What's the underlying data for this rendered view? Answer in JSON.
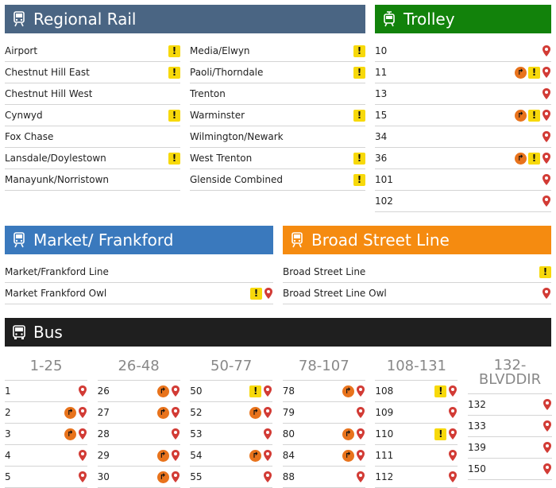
{
  "colors": {
    "regional": "#4a6583",
    "trolley": "#12820b",
    "market": "#3a79bd",
    "broad": "#f58b10",
    "bus": "#1f1f1f"
  },
  "regional": {
    "title": "Regional Rail",
    "left": [
      {
        "name": "Airport",
        "alert": true
      },
      {
        "name": "Chestnut Hill East",
        "alert": true
      },
      {
        "name": "Chestnut Hill West",
        "alert": false
      },
      {
        "name": "Cynwyd",
        "alert": true
      },
      {
        "name": "Fox Chase",
        "alert": false
      },
      {
        "name": "Lansdale/Doylestown",
        "alert": true
      },
      {
        "name": "Manayunk/Norristown",
        "alert": false
      }
    ],
    "right": [
      {
        "name": "Media/Elwyn",
        "alert": true
      },
      {
        "name": "Paoli/Thorndale",
        "alert": true
      },
      {
        "name": "Trenton",
        "alert": false
      },
      {
        "name": "Warminster",
        "alert": true
      },
      {
        "name": "Wilmington/Newark",
        "alert": false
      },
      {
        "name": "West Trenton",
        "alert": true
      },
      {
        "name": "Glenside Combined",
        "alert": true
      }
    ]
  },
  "trolley": {
    "title": "Trolley",
    "routes": [
      {
        "name": "10",
        "detour": false,
        "alert": false
      },
      {
        "name": "11",
        "detour": true,
        "alert": true
      },
      {
        "name": "13",
        "detour": false,
        "alert": false
      },
      {
        "name": "15",
        "detour": true,
        "alert": true
      },
      {
        "name": "34",
        "detour": false,
        "alert": false
      },
      {
        "name": "36",
        "detour": true,
        "alert": true
      },
      {
        "name": "101",
        "detour": false,
        "alert": false
      },
      {
        "name": "102",
        "detour": false,
        "alert": false
      }
    ]
  },
  "market": {
    "title": "Market/ Frankford",
    "routes": [
      {
        "name": "Market/Frankford Line",
        "alert": false,
        "pin": false
      },
      {
        "name": "Market Frankford Owl",
        "alert": true,
        "pin": true
      }
    ]
  },
  "broad": {
    "title": "Broad Street Line",
    "routes": [
      {
        "name": "Broad Street Line",
        "alert": true,
        "pin": false
      },
      {
        "name": "Broad Street Line Owl",
        "alert": false,
        "pin": true
      }
    ]
  },
  "bus": {
    "title": "Bus",
    "columns": [
      {
        "label": "1-25",
        "routes": [
          {
            "name": "1",
            "detour": false,
            "alert": false
          },
          {
            "name": "2",
            "detour": true,
            "alert": false
          },
          {
            "name": "3",
            "detour": true,
            "alert": false
          },
          {
            "name": "4",
            "detour": false,
            "alert": false
          },
          {
            "name": "5",
            "detour": false,
            "alert": false
          }
        ]
      },
      {
        "label": "26-48",
        "routes": [
          {
            "name": "26",
            "detour": true,
            "alert": false
          },
          {
            "name": "27",
            "detour": true,
            "alert": false
          },
          {
            "name": "28",
            "detour": false,
            "alert": false
          },
          {
            "name": "29",
            "detour": true,
            "alert": false
          },
          {
            "name": "30",
            "detour": true,
            "alert": false
          }
        ]
      },
      {
        "label": "50-77",
        "routes": [
          {
            "name": "50",
            "detour": false,
            "alert": true
          },
          {
            "name": "52",
            "detour": true,
            "alert": false
          },
          {
            "name": "53",
            "detour": false,
            "alert": false
          },
          {
            "name": "54",
            "detour": true,
            "alert": false
          },
          {
            "name": "55",
            "detour": false,
            "alert": false
          }
        ]
      },
      {
        "label": "78-107",
        "routes": [
          {
            "name": "78",
            "detour": true,
            "alert": false
          },
          {
            "name": "79",
            "detour": false,
            "alert": false
          },
          {
            "name": "80",
            "detour": true,
            "alert": false
          },
          {
            "name": "84",
            "detour": true,
            "alert": false
          },
          {
            "name": "88",
            "detour": false,
            "alert": false
          }
        ]
      },
      {
        "label": "108-131",
        "routes": [
          {
            "name": "108",
            "detour": false,
            "alert": true
          },
          {
            "name": "109",
            "detour": false,
            "alert": false
          },
          {
            "name": "110",
            "detour": false,
            "alert": true
          },
          {
            "name": "111",
            "detour": false,
            "alert": false
          },
          {
            "name": "112",
            "detour": false,
            "alert": false
          }
        ]
      },
      {
        "label": "132-BLVDDIR",
        "label_line1": "132-",
        "label_line2": "BLVDDIR",
        "routes": [
          {
            "name": "132",
            "detour": false,
            "alert": false
          },
          {
            "name": "133",
            "detour": false,
            "alert": false
          },
          {
            "name": "139",
            "detour": false,
            "alert": false
          },
          {
            "name": "150",
            "detour": false,
            "alert": false
          }
        ]
      }
    ]
  },
  "icons": {
    "alert": "alert-icon",
    "detour": "detour-icon",
    "pin": "map-pin-icon"
  }
}
